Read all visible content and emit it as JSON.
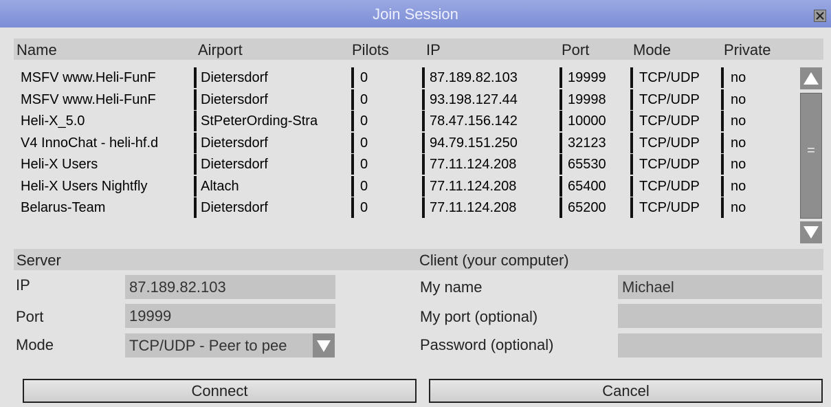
{
  "window": {
    "title": "Join Session"
  },
  "table": {
    "headers": [
      "Name",
      "Airport",
      "Pilots",
      "IP",
      "Port",
      "Mode",
      "Private"
    ],
    "rows": [
      [
        "MSFV www.Heli-FunF",
        "Dietersdorf",
        "0",
        "87.189.82.103",
        "19999",
        "TCP/UDP",
        "no"
      ],
      [
        "MSFV www.Heli-FunF",
        "Dietersdorf",
        "0",
        "93.198.127.44",
        "19998",
        "TCP/UDP",
        "no"
      ],
      [
        "Heli-X_5.0",
        "StPeterOrding-Stra",
        "0",
        "78.47.156.142",
        "10000",
        "TCP/UDP",
        "no"
      ],
      [
        "V4 InnoChat - heli-hf.d",
        "Dietersdorf",
        "0",
        "94.79.151.250",
        "32123",
        "TCP/UDP",
        "no"
      ],
      [
        "Heli-X Users",
        "Dietersdorf",
        "0",
        "77.11.124.208",
        "65530",
        "TCP/UDP",
        "no"
      ],
      [
        "Heli-X Users Nightfly",
        "Altach",
        "0",
        "77.11.124.208",
        "65400",
        "TCP/UDP",
        "no"
      ],
      [
        "Belarus-Team",
        "Dietersdorf",
        "0",
        "77.11.124.208",
        "65200",
        "TCP/UDP",
        "no"
      ]
    ],
    "scroll_grip": "="
  },
  "server": {
    "heading": "Server",
    "ip_label": "IP",
    "ip_value": "87.189.82.103",
    "port_label": "Port",
    "port_value": "19999",
    "mode_label": "Mode",
    "mode_value": "TCP/UDP - Peer to pee"
  },
  "client": {
    "heading": "Client (your computer)",
    "name_label": "My name",
    "name_value": "Michael",
    "port_label": "My port (optional)",
    "port_value": "",
    "password_label": "Password (optional)",
    "password_value": ""
  },
  "buttons": {
    "connect": "Connect",
    "cancel": "Cancel"
  },
  "colors": {
    "titlebar": "#8a9ad9",
    "background": "#e2e2e2",
    "field": "#c4c4c4"
  }
}
